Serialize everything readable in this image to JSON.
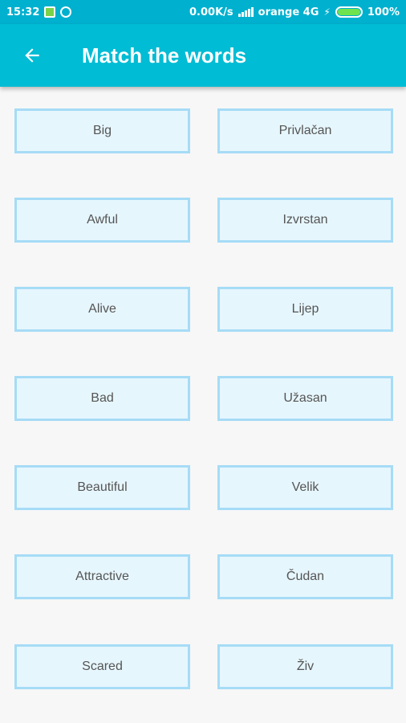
{
  "status_bar": {
    "time": "15:32",
    "network_speed": "0.00K/s",
    "carrier": "orange 4G",
    "battery": "100%",
    "battery_level": 1.0
  },
  "app_bar": {
    "title": "Match the words",
    "back_icon": "arrow-left-icon"
  },
  "colors": {
    "status_bar": "#00b0cf",
    "app_bar": "#00bcd4",
    "tile_bg": "#e6f6fd",
    "tile_border": "#a6dcf6"
  },
  "words": {
    "left": [
      "Big",
      "Awful",
      "Alive",
      "Bad",
      "Beautiful",
      "Attractive",
      "Scared"
    ],
    "right": [
      "Privlačan",
      "Izvrstan",
      "Lijep",
      "Užasan",
      "Velik",
      "Čudan",
      "Živ"
    ]
  }
}
